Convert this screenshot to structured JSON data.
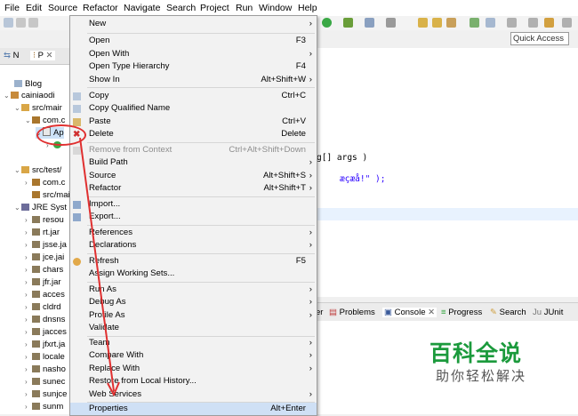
{
  "menubar": [
    "File",
    "Edit",
    "Source",
    "Refactor",
    "Navigate",
    "Search",
    "Project",
    "Run",
    "Window",
    "Help"
  ],
  "toolbar": {
    "quick_access": "Quick Access"
  },
  "left_tabs": [
    {
      "label": "N"
    },
    {
      "label": "P"
    }
  ],
  "tree": [
    {
      "label": "Blog"
    },
    {
      "label": "cainiaodi"
    },
    {
      "label": "src/mair"
    },
    {
      "label": "com.c"
    },
    {
      "label": "Ap"
    },
    {
      "label": "src/test/"
    },
    {
      "label": "com.c"
    },
    {
      "label": "src/mair"
    },
    {
      "label": "JRE Syst"
    },
    {
      "label": "resou"
    },
    {
      "label": "rt.jar"
    },
    {
      "label": "jsse.ja"
    },
    {
      "label": "jce.jai"
    },
    {
      "label": "chars"
    },
    {
      "label": "jfr.jar"
    },
    {
      "label": "acces"
    },
    {
      "label": "cldrd"
    },
    {
      "label": "dnsns"
    },
    {
      "label": "jacces"
    },
    {
      "label": "jfxrt.ja"
    },
    {
      "label": "locale"
    },
    {
      "label": "nasho"
    },
    {
      "label": "sunec"
    },
    {
      "label": "sunjce"
    },
    {
      "label": "sunm"
    }
  ],
  "editor": {
    "line1": "g[] args )",
    "line2": "æçæå!\" );"
  },
  "bottom_tabs": [
    "er",
    "Problems",
    "Console",
    "Progress",
    "Search",
    "JUnit"
  ],
  "watermark": {
    "title": "百科全说",
    "subtitle": "助你轻松解决"
  },
  "context_menu": [
    {
      "label": "New",
      "shortcut": "",
      "submenu": true
    },
    {
      "label": "Open",
      "shortcut": "F3",
      "submenu": false
    },
    {
      "label": "Open With",
      "shortcut": "",
      "submenu": true
    },
    {
      "label": "Open Type Hierarchy",
      "shortcut": "F4",
      "submenu": false
    },
    {
      "label": "Show In",
      "shortcut": "Alt+Shift+W",
      "submenu": true
    },
    {
      "label": "Copy",
      "shortcut": "Ctrl+C",
      "submenu": false
    },
    {
      "label": "Copy Qualified Name",
      "shortcut": "",
      "submenu": false
    },
    {
      "label": "Paste",
      "shortcut": "Ctrl+V",
      "submenu": false
    },
    {
      "label": "Delete",
      "shortcut": "Delete",
      "submenu": false
    },
    {
      "label": "Remove from Context",
      "shortcut": "Ctrl+Alt+Shift+Down",
      "submenu": false
    },
    {
      "label": "Build Path",
      "shortcut": "",
      "submenu": true
    },
    {
      "label": "Source",
      "shortcut": "Alt+Shift+S",
      "submenu": true
    },
    {
      "label": "Refactor",
      "shortcut": "Alt+Shift+T",
      "submenu": true
    },
    {
      "label": "Import...",
      "shortcut": "",
      "submenu": false
    },
    {
      "label": "Export...",
      "shortcut": "",
      "submenu": false
    },
    {
      "label": "References",
      "shortcut": "",
      "submenu": true
    },
    {
      "label": "Declarations",
      "shortcut": "",
      "submenu": true
    },
    {
      "label": "Refresh",
      "shortcut": "F5",
      "submenu": false
    },
    {
      "label": "Assign Working Sets...",
      "shortcut": "",
      "submenu": false
    },
    {
      "label": "Run As",
      "shortcut": "",
      "submenu": true
    },
    {
      "label": "Debug As",
      "shortcut": "",
      "submenu": true
    },
    {
      "label": "Profile As",
      "shortcut": "",
      "submenu": true
    },
    {
      "label": "Validate",
      "shortcut": "",
      "submenu": false
    },
    {
      "label": "Team",
      "shortcut": "",
      "submenu": true
    },
    {
      "label": "Compare With",
      "shortcut": "",
      "submenu": true
    },
    {
      "label": "Replace With",
      "shortcut": "",
      "submenu": true
    },
    {
      "label": "Restore from Local History...",
      "shortcut": "",
      "submenu": false
    },
    {
      "label": "Web Services",
      "shortcut": "",
      "submenu": true
    },
    {
      "label": "Properties",
      "shortcut": "Alt+Enter",
      "submenu": false
    }
  ],
  "colors": {
    "annotation": "#e03030",
    "watermark": "#1b9a3c",
    "selected": "#cfe0f5"
  }
}
